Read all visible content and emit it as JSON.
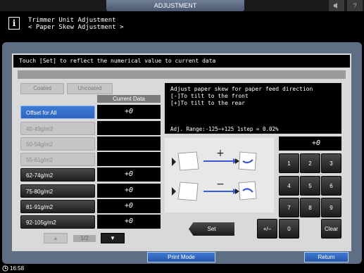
{
  "top": {
    "tab_label": "ADJUSTMENT",
    "icon_sound": "speaker-icon",
    "icon_help": "help-icon",
    "help_label": "?"
  },
  "header": {
    "line1": "Trimmer Unit Adjustment",
    "line2": "< Paper Skew Adjustment >",
    "info_glyph": "i"
  },
  "message": "Touch [Set] to reflect the numerical value to current data",
  "tabs": {
    "coated": "Coated",
    "uncoated": "Uncoated"
  },
  "current_data_header": "Current Data",
  "rows": [
    {
      "label": "Offset for All",
      "value": "+0"
    },
    {
      "label": "40-49g/m2",
      "value": ""
    },
    {
      "label": "50-54g/m2",
      "value": ""
    },
    {
      "label": "55-61g/m2",
      "value": ""
    },
    {
      "label": "62-74g/m2",
      "value": "+0"
    },
    {
      "label": "75-80g/m2",
      "value": "+0"
    },
    {
      "label": "81-91g/m2",
      "value": "+0"
    },
    {
      "label": "92-105g/m2",
      "value": "+0"
    }
  ],
  "pager": {
    "prev": "▲",
    "next": "▼",
    "indicator": "1/2"
  },
  "description": {
    "line1": "Adjust paper skew for paper feed direction",
    "line2": "[-]To tilt to the front",
    "line3": "[+]To tilt to the rear",
    "range": "Adj. Range:-125~+125 1step = 0.02%"
  },
  "illustration": {
    "plus": "+",
    "minus": "−"
  },
  "display_value": "+0",
  "keypad": {
    "k1": "1",
    "k2": "2",
    "k3": "3",
    "k4": "4",
    "k5": "5",
    "k6": "6",
    "k7": "7",
    "k8": "8",
    "k9": "9",
    "k0": "0",
    "plusminus": "+/−",
    "clear": "Clear"
  },
  "set_label": "Set",
  "print_mode_label": "Print Mode",
  "return_label": "Return",
  "status": {
    "time": "16:58"
  }
}
